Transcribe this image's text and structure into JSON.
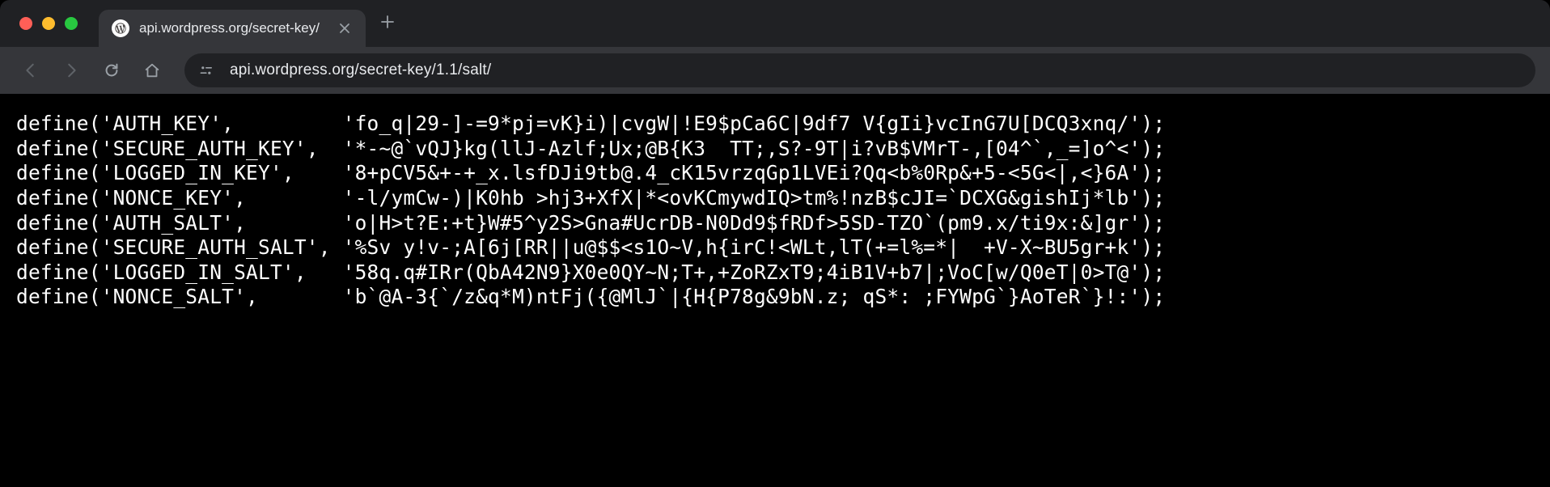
{
  "tab": {
    "title": "api.wordpress.org/secret-key/",
    "favicon_label": "wordpress-favicon"
  },
  "url": "api.wordpress.org/secret-key/1.1/salt/",
  "controls": {
    "close": "close",
    "minimize": "minimize",
    "maximize": "maximize",
    "back": "back",
    "forward": "forward",
    "reload": "reload",
    "home": "home",
    "new_tab": "+"
  },
  "defines": [
    {
      "key": "AUTH_KEY",
      "pad": "        ",
      "value": "fo_q|29-]-=9*pj=vK}i)|cvgW|!E9$pCa6C|9df7 V{gIi}vcInG7U[DCQ3xnq/"
    },
    {
      "key": "SECURE_AUTH_KEY",
      "pad": " ",
      "value": "*-~@`vQJ}kg(llJ-Azlf;Ux;@B{K3  TT;,S?-9T|i?vB$VMrT-,[04^`,_=]o^<"
    },
    {
      "key": "LOGGED_IN_KEY",
      "pad": "   ",
      "value": "8+pCV5&+-+_x.lsfDJi9tb@.4_cK15vrzqGp1LVEi?Qq<b%0Rp&+5-<5G<|,<}6A"
    },
    {
      "key": "NONCE_KEY",
      "pad": "       ",
      "value": "-l/ymCw-)|K0hb >hj3+XfX|*<ovKCmywdIQ>tm%!nzB$cJI=`DCXG&gishIj*lb"
    },
    {
      "key": "AUTH_SALT",
      "pad": "       ",
      "value": "o|H>t?E:+t}W#5^y2S>Gna#UcrDB-N0Dd9$fRDf>5SD-TZO`(pm9.x/ti9x:&]gr"
    },
    {
      "key": "SECURE_AUTH_SALT",
      "pad": "",
      "value": "%Sv y!v-;A[6j[RR||u@$$<s1O~V,h{irC!<WLt,lT(+=l%=*|  +V-X~BU5gr+k"
    },
    {
      "key": "LOGGED_IN_SALT",
      "pad": "  ",
      "value": "58q.q#IRr(QbA42N9}X0e0QY~N;T+,+ZoRZxT9;4iB1V+b7|;VoC[w/Q0eT|0>T@"
    },
    {
      "key": "NONCE_SALT",
      "pad": "      ",
      "value": "b`@A-3{`/z&q*M)ntFj({@MlJ`|{H{P78g&9bN.z; qS*: ;FYWpG`}AoTeR`}!:"
    }
  ]
}
